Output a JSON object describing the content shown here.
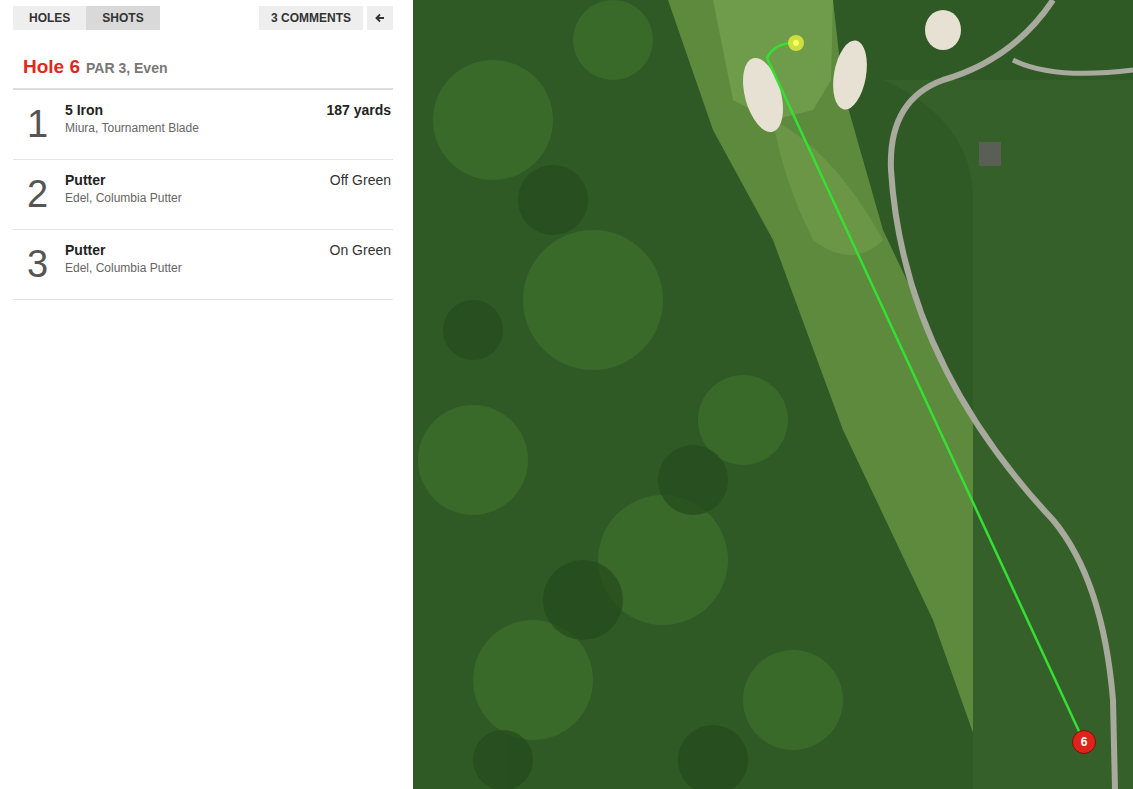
{
  "tabs": [
    {
      "label": "HOLES",
      "selected": false
    },
    {
      "label": "SHOTS",
      "selected": true
    }
  ],
  "comments": {
    "label": "3 COMMENTS"
  },
  "hole": {
    "title": "Hole 6",
    "summary": "PAR 3, Even"
  },
  "shots": [
    {
      "number": "1",
      "club": "5 Iron",
      "model": "Miura, Tournament Blade",
      "result": "187 yards",
      "kind": "distance"
    },
    {
      "number": "2",
      "club": "Putter",
      "model": "Edel, Columbia Putter",
      "result": "Off Green",
      "kind": "location"
    },
    {
      "number": "3",
      "club": "Putter",
      "model": "Edel, Columbia Putter",
      "result": "On Green",
      "kind": "location"
    }
  ],
  "map": {
    "marker": "6"
  }
}
